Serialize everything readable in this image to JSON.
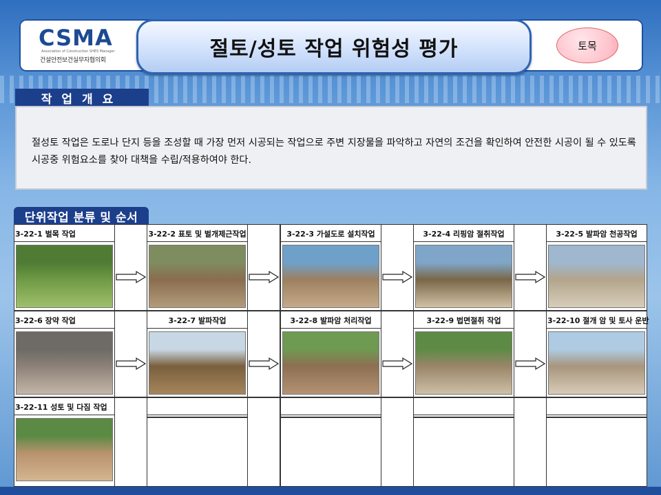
{
  "logo": {
    "main": "CSMA",
    "sub": "Association of Construction SHES Manager",
    "kor": "건설안전보건실무자협의회"
  },
  "title": "절토/성토 작업 위험성 평가",
  "badge": "토목",
  "overview": {
    "heading": "작업개요",
    "text": "절성토 작업은 도로나 단지 등을 조성할 때 가장 먼저 시공되는 작업으로 주변 지장물을 파악하고 자연의 조건을 확인하여 안전한 시공이 될 수 있도록 시공중 위험요소를 찾아 대책을 수립/적용하여야 한다."
  },
  "steps": {
    "heading": "단위작업 분류 및 순서",
    "items": [
      {
        "label": "3-22-1  벌목 작업",
        "photo": "tree-felling-photo"
      },
      {
        "label": "3-22-2 표토 및 벌개제근작업",
        "photo": "topsoil-clearing-photo"
      },
      {
        "label": "3-22-3 가설도로 설치작업",
        "photo": "temporary-road-photo"
      },
      {
        "label": "3-22-4  리핑암 절취작업",
        "photo": "ripping-rock-photo"
      },
      {
        "label": "3-22-5  발파암 천공작업",
        "photo": "blast-drilling-photo"
      },
      {
        "label": "3-22-6  장약 작업",
        "photo": "charging-photo"
      },
      {
        "label": "3-22-7 발파작업",
        "photo": "blasting-photo"
      },
      {
        "label": "3-22-8 발파암 처리작업",
        "photo": "blasted-rock-photo"
      },
      {
        "label": "3-22-9  법면절취 작업",
        "photo": "slope-cutting-photo"
      },
      {
        "label": "3-22-10 절개 암 및 토사 운반",
        "photo": "hauling-photo"
      },
      {
        "label": "3-22-11  성토 및 다짐 작업",
        "photo": "fill-compaction-photo"
      }
    ]
  },
  "colors": {
    "navy": "#1c3f8c",
    "border": "#2d62b6",
    "badge": "#ffc1cb"
  }
}
